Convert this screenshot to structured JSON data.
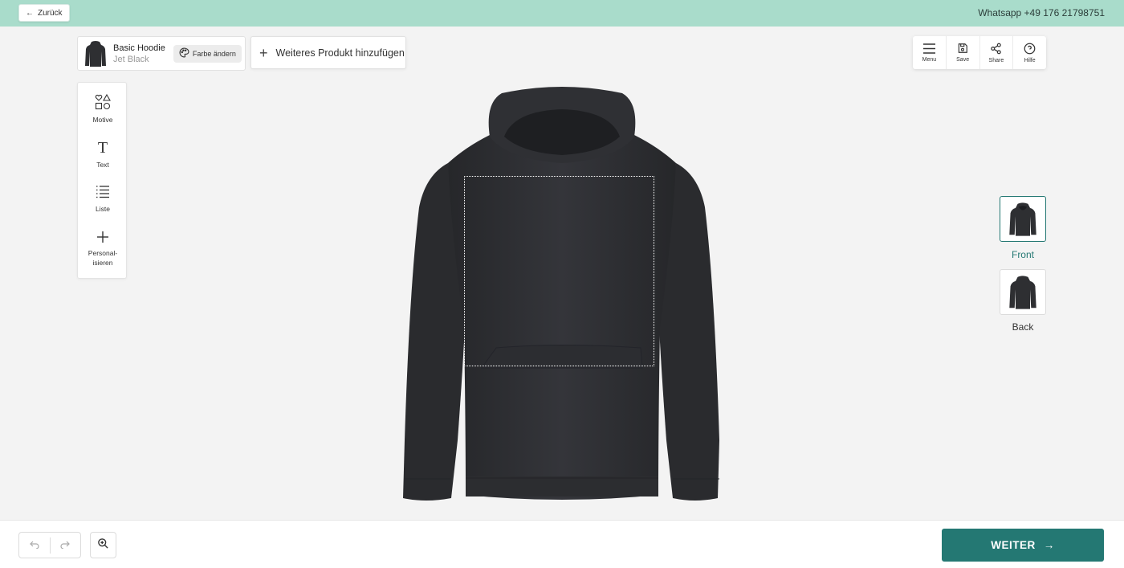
{
  "header": {
    "back_label": "Zurück",
    "contact": "Whatsapp +49 176 21798751"
  },
  "product": {
    "name": "Basic Hoodie",
    "color": "Jet Black",
    "change_color_label": "Farbe ändern"
  },
  "add_product_label": "Weiteres Produkt hinzufügen",
  "toolbar": {
    "items": [
      {
        "label": "Menu",
        "icon": "menu-icon"
      },
      {
        "label": "Save",
        "icon": "save-icon"
      },
      {
        "label": "Share",
        "icon": "share-icon"
      },
      {
        "label": "Hilfe",
        "icon": "help-icon"
      }
    ]
  },
  "sidebar": {
    "items": [
      {
        "label": "Motive",
        "icon": "shapes-icon"
      },
      {
        "label": "Text",
        "icon": "text-icon"
      },
      {
        "label": "Liste",
        "icon": "list-icon"
      },
      {
        "label": "Personal-\nisieren",
        "icon": "plus-icon"
      }
    ]
  },
  "views": {
    "front_label": "Front",
    "back_label": "Back",
    "selected": "Front"
  },
  "footer": {
    "next_label": "WEITER"
  },
  "colors": {
    "header_bg": "#a9dccb",
    "accent": "#247873",
    "hoodie": "#2e2f32"
  }
}
